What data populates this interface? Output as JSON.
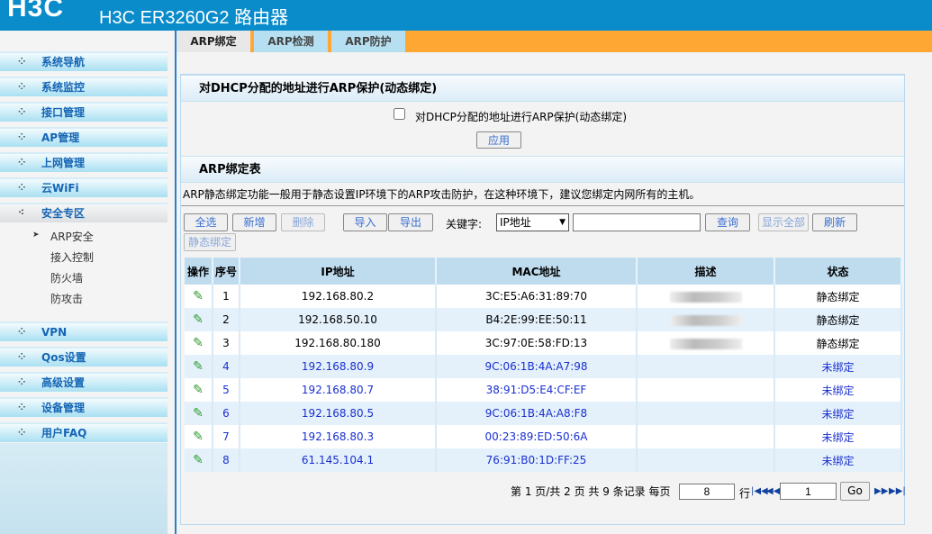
{
  "header": {
    "logo": "H3C",
    "title": "H3C ER3260G2 路由器"
  },
  "sidebar": {
    "items": [
      {
        "label": "系统导航"
      },
      {
        "label": "系统监控"
      },
      {
        "label": "接口管理"
      },
      {
        "label": "AP管理"
      },
      {
        "label": "上网管理"
      },
      {
        "label": "云WiFi"
      },
      {
        "label": "安全专区",
        "expanded": true
      },
      {
        "label": "VPN"
      },
      {
        "label": "Qos设置"
      },
      {
        "label": "高级设置"
      },
      {
        "label": "设备管理"
      },
      {
        "label": "用户FAQ"
      }
    ],
    "sub_items": [
      {
        "label": "ARP安全",
        "active": true
      },
      {
        "label": "接入控制"
      },
      {
        "label": "防火墙"
      },
      {
        "label": "防攻击"
      }
    ]
  },
  "tabs": [
    {
      "label": "ARP绑定",
      "active": true
    },
    {
      "label": "ARP检测"
    },
    {
      "label": "ARP防护"
    }
  ],
  "dhcp": {
    "title": "对DHCP分配的地址进行ARP保护(动态绑定)",
    "checkbox_label": "对DHCP分配的地址进行ARP保护(动态绑定)",
    "checked": false,
    "apply": "应用"
  },
  "arp": {
    "title": "ARP绑定表",
    "desc": "ARP静态绑定功能一般用于静态设置IP环境下的ARP攻击防护，在这种环境下，建议您绑定内网所有的主机。",
    "buttons": {
      "select_all": "全选",
      "add": "新增",
      "delete": "删除",
      "import": "导入",
      "export": "导出",
      "search": "查询",
      "show_all": "显示全部",
      "refresh": "刷新",
      "static_bind": "静态绑定"
    },
    "keyword_label": "关键字:",
    "keyword_select": "IP地址",
    "keyword_value": "",
    "columns": [
      "操作",
      "序号",
      "IP地址",
      "MAC地址",
      "描述",
      "状态"
    ],
    "rows": [
      {
        "no": "1",
        "ip": "192.168.80.2",
        "mac": "3C:E5:A6:31:89:70",
        "status": "静态绑定"
      },
      {
        "no": "2",
        "ip": "192.168.50.10",
        "mac": "B4:2E:99:EE:50:11",
        "status": "静态绑定"
      },
      {
        "no": "3",
        "ip": "192.168.80.180",
        "mac": "3C:97:0E:58:FD:13",
        "status": "静态绑定"
      },
      {
        "no": "4",
        "ip": "192.168.80.9",
        "mac": "9C:06:1B:4A:A7:98",
        "status": "未绑定"
      },
      {
        "no": "5",
        "ip": "192.168.80.7",
        "mac": "38:91:D5:E4:CF:EF",
        "status": "未绑定"
      },
      {
        "no": "6",
        "ip": "192.168.80.5",
        "mac": "9C:06:1B:4A:A8:F8",
        "status": "未绑定"
      },
      {
        "no": "7",
        "ip": "192.168.80.3",
        "mac": "00:23:89:ED:50:6A",
        "status": "未绑定"
      },
      {
        "no": "8",
        "ip": "61.145.104.1",
        "mac": "76:91:B0:1D:FF:25",
        "status": "未绑定"
      }
    ]
  },
  "pager": {
    "summary": "第 1 页/共 2 页 共 9 条记录 每页",
    "per_page": "8",
    "row_label": "行",
    "page": "1",
    "go": "Go"
  }
}
